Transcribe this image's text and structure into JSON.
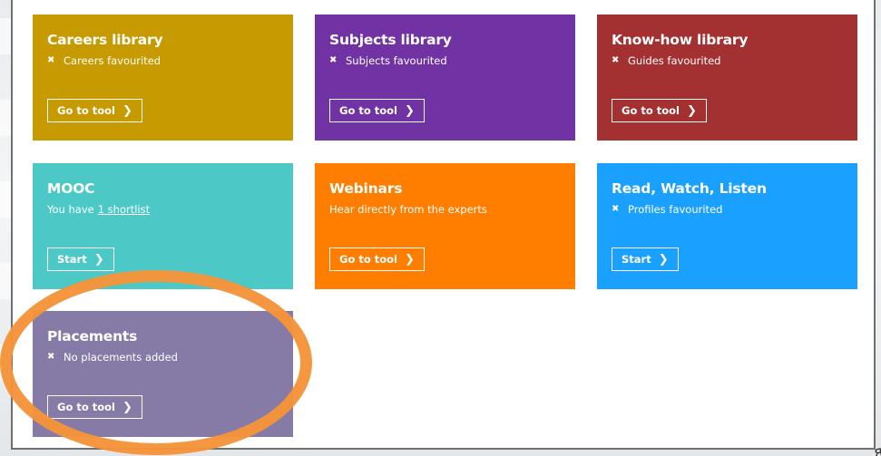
{
  "tiles": [
    {
      "key": "careers",
      "title": "Careers library",
      "subtitle": "Careers favourited",
      "has_cross": true,
      "button": "Go to tool",
      "color": "#c69a00"
    },
    {
      "key": "subjects",
      "title": "Subjects library",
      "subtitle": "Subjects favourited",
      "has_cross": true,
      "button": "Go to tool",
      "color": "#7133a3"
    },
    {
      "key": "knowhow",
      "title": "Know-how library",
      "subtitle": "Guides favourited",
      "has_cross": true,
      "button": "Go to tool",
      "color": "#a33131"
    },
    {
      "key": "mooc",
      "title": "MOOC",
      "subtitle_prefix": "You have",
      "subtitle_link": "1 shortlist",
      "button": "Start",
      "color": "#4cc9c6"
    },
    {
      "key": "webinars",
      "title": "Webinars",
      "subtitle": "Hear directly from the experts",
      "has_cross": false,
      "button": "Go to tool",
      "color": "#ff7e00"
    },
    {
      "key": "rwl",
      "title": "Read, Watch, Listen",
      "subtitle": "Profiles favourited",
      "has_cross": true,
      "button": "Start",
      "color": "#1aa1ff"
    },
    {
      "key": "placements",
      "title": "Placements",
      "subtitle": "No placements added",
      "has_cross": true,
      "button": "Go to tool",
      "color": "#857ba6"
    }
  ],
  "icons": {
    "cross": "cross-icon",
    "chevron": "chevron-right-icon"
  },
  "annotation": {
    "highlight_color": "#f5943a"
  }
}
